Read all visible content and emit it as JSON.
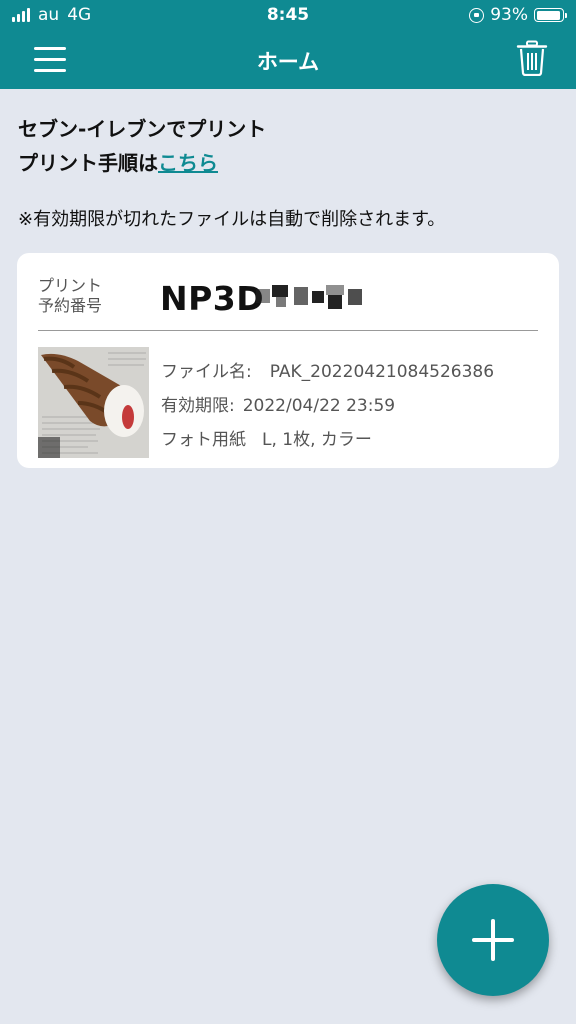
{
  "status_bar": {
    "carrier": "au",
    "network": "4G",
    "time": "8:45",
    "battery": "93%",
    "battery_level": 0.93
  },
  "nav": {
    "title": "ホーム",
    "menu_icon": "hamburger-menu-icon",
    "trash_icon": "trash-icon"
  },
  "intro": {
    "line1": "セブン-イレブンでプリント",
    "line2_prefix": "プリント手順は",
    "line2_link": "こちら"
  },
  "notice": "※有効期限が切れたファイルは自動で削除されます。",
  "card": {
    "reservation_label_line1": "プリント",
    "reservation_label_line2": "予約番号",
    "reservation_number": "NP3D",
    "file_name_label": "ファイル名:",
    "file_name": "PAK_20220421084526386",
    "expiry_label": "有効期限:",
    "expiry": "2022/04/22 23:59",
    "paper_label": "フォト用紙",
    "paper_value": "L, 1枚, カラー"
  },
  "fab": {
    "icon": "plus-icon"
  },
  "colors": {
    "primary": "#0f8a92",
    "background": "#e3e7ef",
    "card": "#ffffff"
  }
}
